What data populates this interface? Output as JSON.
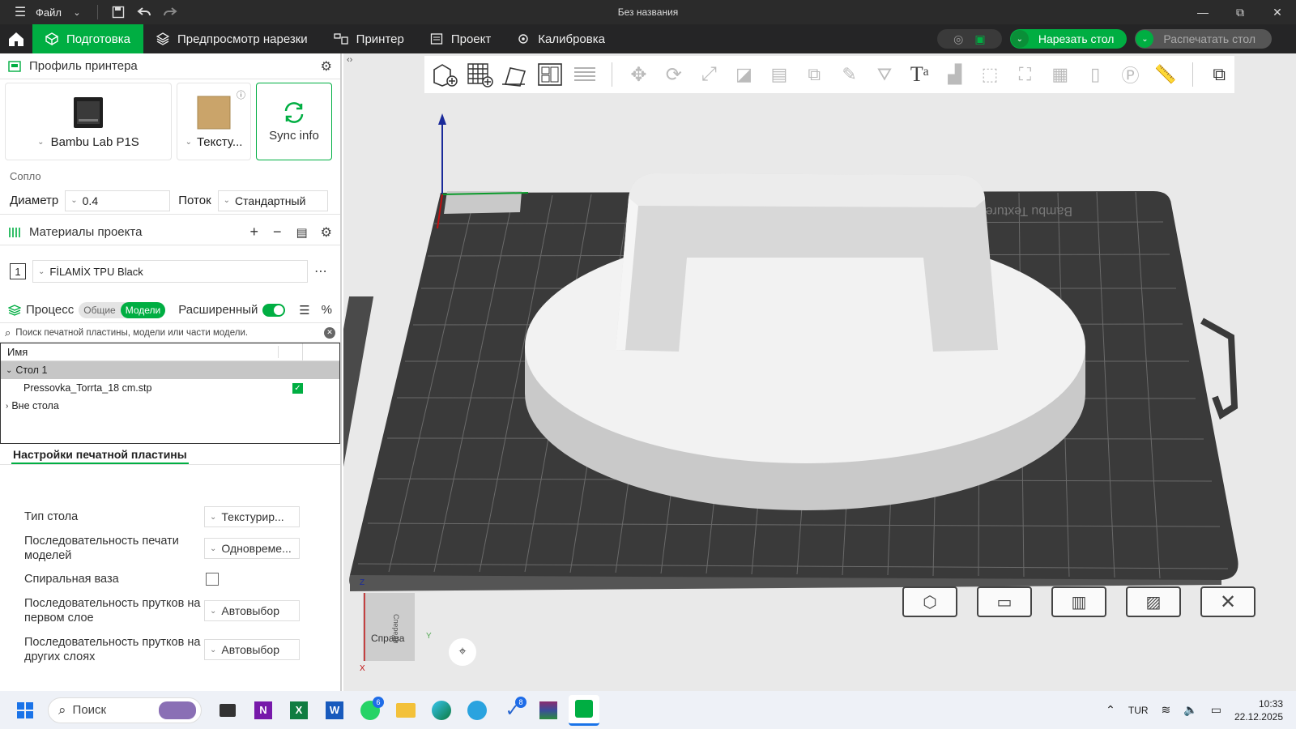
{
  "titlebar": {
    "menu_label": "Файл",
    "title": "Без названия"
  },
  "tabs": [
    {
      "label": "Подготовка"
    },
    {
      "label": "Предпросмотр нарезки"
    },
    {
      "label": "Принтер"
    },
    {
      "label": "Проект"
    },
    {
      "label": "Калибровка"
    }
  ],
  "actions": {
    "slice_label": "Нарезать стол",
    "print_label": "Распечатать стол"
  },
  "printer": {
    "section_title": "Профиль принтера",
    "printer_name": "Bambu Lab P1S",
    "plate_name": "Тексту...",
    "sync_label": "Sync info",
    "nozzle_label": "Сопло",
    "diameter_label": "Диаметр",
    "diameter_value": "0.4",
    "flow_label": "Поток",
    "flow_value": "Стандартный"
  },
  "materials": {
    "section_title": "Материалы проекта",
    "slot": "1",
    "filament": "FİLAMİX TPU Black"
  },
  "process": {
    "section_title": "Процесс",
    "toggle_general": "Общие",
    "toggle_models": "Модели",
    "advanced_label": "Расширенный",
    "search_placeholder": "Поиск печатной пластины, модели или части модели."
  },
  "tree": {
    "col_name": "Имя",
    "plate": "Стол 1",
    "model": "Pressovka_Torrta_18 cm.stp",
    "off_plate": "Вне стола"
  },
  "plate_settings": {
    "tab_label": "Настройки печатной пластины",
    "rows": [
      {
        "label": "Тип стола",
        "value": "Текстурир..."
      },
      {
        "label": "Последовательность печати моделей",
        "value": "Одновреме..."
      },
      {
        "label": "Спиральная ваза",
        "value": ""
      },
      {
        "label": "Последовательность прутков на первом слое",
        "value": "Автовыбор"
      },
      {
        "label": "Последовательность прутков на других слоях",
        "value": "Автовыбор"
      }
    ]
  },
  "viewport": {
    "bed_text": "Bambu Texture",
    "axis_label_right": "Справа",
    "axis_label_y": "Y",
    "axis_label_x": "X",
    "axis_label_z": "Z",
    "view_label_front": "Спереди"
  },
  "taskbar": {
    "search_label": "Поиск",
    "lang": "TUR",
    "time": "10:33",
    "date": "22.12.2025",
    "whatsapp_badge": "6",
    "todo_badge": "8"
  },
  "colors": {
    "accent": "#00ae42",
    "bed": "#3a3a3a",
    "model": "#f2f2f2"
  }
}
